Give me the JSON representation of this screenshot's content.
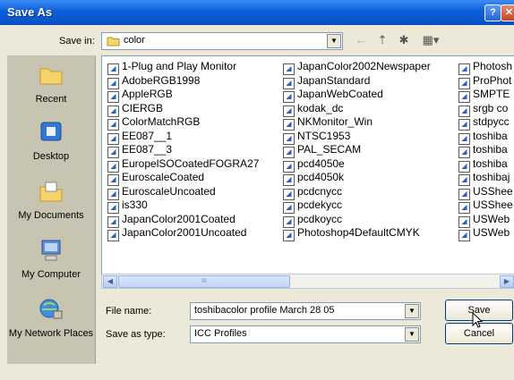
{
  "window": {
    "title": "Save As",
    "help_glyph": "?",
    "close_glyph": "✕"
  },
  "save_in": {
    "label": "Save in:",
    "value": "color"
  },
  "toolbar": {
    "back_glyph": "←",
    "up_glyph": "⇡",
    "new_folder_glyph": "✱",
    "views_glyph": "▦▾"
  },
  "places": [
    {
      "label": "Recent",
      "icon": "recent-folder-icon"
    },
    {
      "label": "Desktop",
      "icon": "desktop-icon"
    },
    {
      "label": "My Documents",
      "icon": "my-documents-icon"
    },
    {
      "label": "My Computer",
      "icon": "my-computer-icon"
    },
    {
      "label": "My Network Places",
      "icon": "network-places-icon"
    }
  ],
  "files": {
    "col1": [
      "1-Plug and Play Monitor",
      "AdobeRGB1998",
      "AppleRGB",
      "CIERGB",
      "ColorMatchRGB",
      "EE087__1",
      "EE087__3",
      "EuropelSOCoatedFOGRA27",
      "EuroscaleCoated",
      "EuroscaleUncoated",
      "is330",
      "JapanColor2001Coated",
      "JapanColor2001Uncoated"
    ],
    "col2": [
      "JapanColor2002Newspaper",
      "JapanStandard",
      "JapanWebCoated",
      "kodak_dc",
      "NKMonitor_Win",
      "NTSC1953",
      "PAL_SECAM",
      "pcd4050e",
      "pcd4050k",
      "pcdcnycc",
      "pcdekycc",
      "pcdkoycc",
      "Photoshop4DefaultCMYK"
    ],
    "col3": [
      "Photosh",
      "ProPhot",
      "SMPTE",
      "srgb co",
      "stdpycc",
      "toshiba",
      "toshiba",
      "toshiba",
      "toshibaj",
      "USShee",
      "USShee",
      "USWeb",
      "USWeb"
    ]
  },
  "file_name": {
    "label": "File name:",
    "value": "toshibacolor profile March 28 05"
  },
  "save_type": {
    "label": "Save as type:",
    "value": "ICC Profiles"
  },
  "buttons": {
    "save": "Save",
    "cancel": "Cancel"
  },
  "scroll": {
    "left": "◀",
    "right": "▶",
    "grip": "III"
  },
  "colors": {
    "title_bar": "#0a5fd8",
    "panel": "#ece9d8",
    "places_bar": "#c7c5b2"
  }
}
